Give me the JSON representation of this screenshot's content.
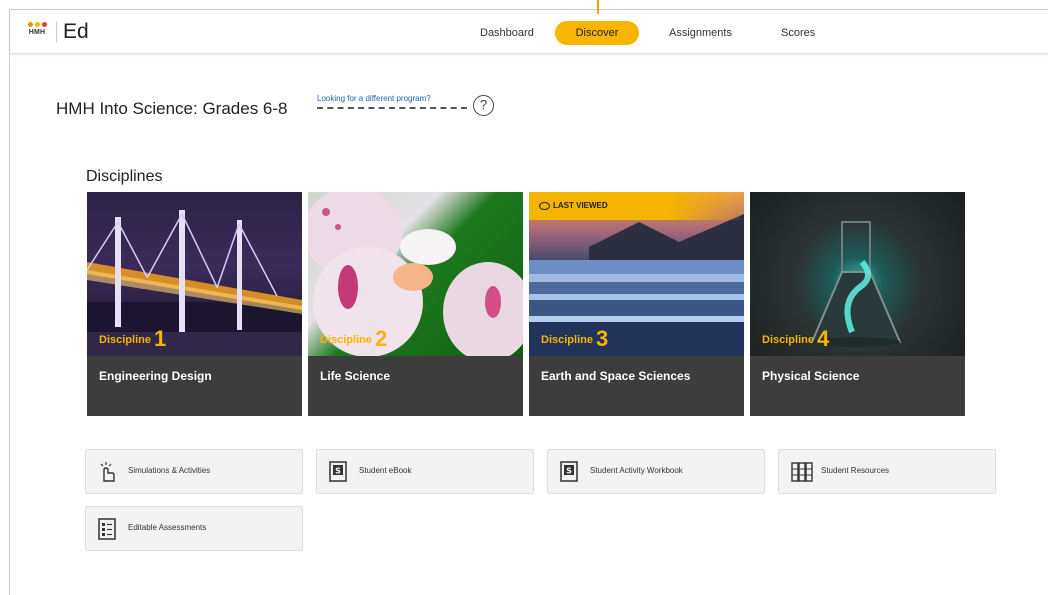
{
  "header": {
    "logo_text": "HMH",
    "app_name": "Ed",
    "nav": [
      {
        "label": "Dashboard"
      },
      {
        "label": "Discover"
      },
      {
        "label": "Assignments"
      },
      {
        "label": "Scores"
      }
    ],
    "active_nav": "Discover"
  },
  "program": {
    "title": "HMH Into Science: Grades 6-8",
    "different_link": "Looking for a different program?",
    "help_icon": "question-circle-icon"
  },
  "disciplines": {
    "title": "Disciplines",
    "badge_last_viewed": "LAST VIEWED",
    "cards": [
      {
        "discipline_label": "Discipline",
        "number": "1",
        "name": "Engineering Design"
      },
      {
        "discipline_label": "Discipline",
        "number": "2",
        "name": "Life Science"
      },
      {
        "discipline_label": "Discipline",
        "number": "3",
        "name": "Earth and Space Sciences"
      },
      {
        "discipline_label": "Discipline",
        "number": "4",
        "name": "Physical Science"
      }
    ]
  },
  "resources": [
    {
      "label": "Simulations & Activities",
      "icon": "touch-hand-icon"
    },
    {
      "label": "Student eBook",
      "icon": "ebook-icon"
    },
    {
      "label": "Student Activity Workbook",
      "icon": "workbook-icon"
    },
    {
      "label": "Student Resources",
      "icon": "resources-icon"
    },
    {
      "label": "Editable Assessments",
      "icon": "checklist-icon"
    }
  ],
  "colors": {
    "accent": "#f7b500",
    "card_bg": "#3d3d3d",
    "link": "#1d63b7"
  }
}
